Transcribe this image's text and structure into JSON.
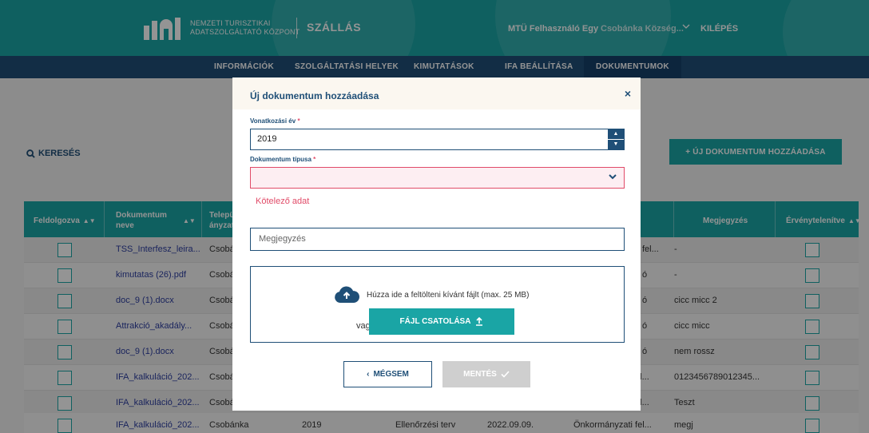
{
  "header": {
    "logo_line1": "NEMZETI TURISZTIKAI",
    "logo_line2": "ADATSZOLGÁLTATÓ KÖZPONT",
    "app_title": "SZÁLLÁS",
    "user_name": "MTÜ Felhasználó Egy",
    "user_org": "Csobánka Község...",
    "logout_label": "KILÉPÉS",
    "icons": [
      "ntak-logo-icon",
      "chevron-down-icon"
    ]
  },
  "nav": {
    "items": [
      {
        "label": "INFORMÁCIÓK"
      },
      {
        "label": "SZOLGÁLTATÁSI HELYEK"
      },
      {
        "label": "KIMUTATÁSOK"
      },
      {
        "label": "IFA BEÁLLÍTÁSA"
      },
      {
        "label": "DOKUMENTUMOK",
        "active": true
      }
    ]
  },
  "page": {
    "search_label": "KERESÉS",
    "new_doc_label": "+ ÚJ DOKUMENTUM HOZZÁADÁSA"
  },
  "table": {
    "headers": {
      "processed": "Feldolgozva",
      "doc_name": "Dokumentum neve",
      "settlement": "Telepü ányzat",
      "note": "Megjegyzés",
      "invalidated": "Érvénytelenítve"
    },
    "rows": [
      {
        "name": "TSS_Interfesz_leira...",
        "settlement": "Csobá",
        "col5": "fel...",
        "note": "-"
      },
      {
        "name": "kimutatas (26).pdf",
        "settlement": "Csobá",
        "col5": "ó",
        "note": "-"
      },
      {
        "name": "doc_9 (1).docx",
        "settlement": "Csobá",
        "col5": "ó",
        "note": "cicc micc 2"
      },
      {
        "name": "Attrakció_akadály...",
        "settlement": "Csobá",
        "col5": "ó",
        "note": "cicc micc"
      },
      {
        "name": "doc_9 (1).docx",
        "settlement": "Csobá",
        "col5": "ó",
        "note": "nem rossz"
      },
      {
        "name": "IFA_kalkuláció_202...",
        "settlement": "Csobá",
        "col5": "fel...",
        "note": "0123456789012345..."
      },
      {
        "name": "IFA_kalkuláció_202...",
        "settlement": "Csobá",
        "col5": "fel...",
        "note": "Teszt"
      },
      {
        "name": "IFA_kalkuláció_202...",
        "settlement": "Csobánka",
        "year": "2019",
        "type": "Ellenőrzési terv",
        "date": "2022.09.09.",
        "col5": "Önkormányzati fel...",
        "note": "megj"
      }
    ]
  },
  "modal": {
    "title": "Új dokumentum hozzáadása",
    "close_symbol": "×",
    "year_label": "Vonatkozási év",
    "year_value": "2019",
    "type_label": "Dokumentum típusa",
    "required_mark": "*",
    "error_text": "Kötelező adat",
    "note_placeholder": "Megjegyzés",
    "drop_text": "Húzza ide a feltölteni kívánt fájlt (max. 25 MB)",
    "or_text": "vagy",
    "attach_label": "FÁJL CSATOLÁSA",
    "cancel_label": "MÉGSEM",
    "save_label": "MENTÉS"
  },
  "colors": {
    "teal": "#1aa5a5",
    "navy": "#1f4f77",
    "error": "#e14b68",
    "link": "#2d3ea0"
  }
}
